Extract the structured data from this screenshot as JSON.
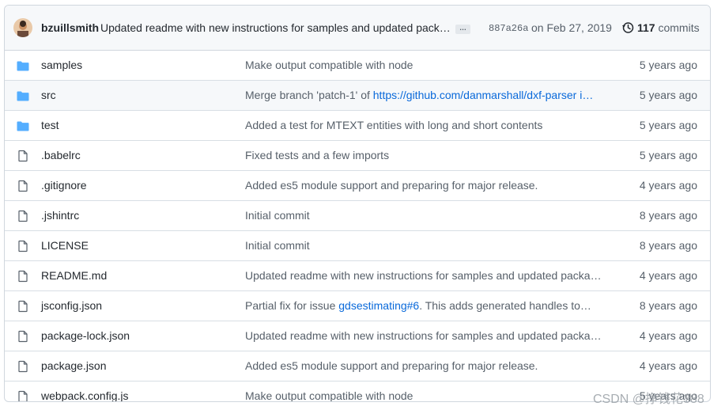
{
  "commit": {
    "author": "bzuillsmith",
    "message": "Updated readme with new instructions for samples and updated pack…",
    "more": "…",
    "sha": "887a26a",
    "date": "on Feb 27, 2019",
    "commit_count": "117",
    "commits_label": "commits"
  },
  "files": [
    {
      "type": "folder",
      "name": "samples",
      "message": "Make output compatible with node",
      "age": "5 years ago"
    },
    {
      "type": "folder",
      "name": "src",
      "message_prefix": "Merge branch 'patch-1' of ",
      "message_link": "https://github.com/danmarshall/dxf-parser i…",
      "age": "5 years ago"
    },
    {
      "type": "folder",
      "name": "test",
      "message": "Added a test for MTEXT entities with long and short contents",
      "age": "5 years ago"
    },
    {
      "type": "file",
      "name": ".babelrc",
      "message": "Fixed tests and a few imports",
      "age": "5 years ago"
    },
    {
      "type": "file",
      "name": ".gitignore",
      "message": "Added es5 module support and preparing for major release.",
      "age": "4 years ago"
    },
    {
      "type": "file",
      "name": ".jshintrc",
      "message": "Initial commit",
      "age": "8 years ago"
    },
    {
      "type": "file",
      "name": "LICENSE",
      "message": "Initial commit",
      "age": "8 years ago"
    },
    {
      "type": "file",
      "name": "README.md",
      "message": "Updated readme with new instructions for samples and updated packag…",
      "age": "4 years ago"
    },
    {
      "type": "file",
      "name": "jsconfig.json",
      "message_prefix": "Partial fix for issue ",
      "message_link": "gdsestimating#6",
      "message_suffix": ". This adds generated handles to…",
      "age": "8 years ago"
    },
    {
      "type": "file",
      "name": "package-lock.json",
      "message": "Updated readme with new instructions for samples and updated packag…",
      "age": "4 years ago"
    },
    {
      "type": "file",
      "name": "package.json",
      "message": "Added es5 module support and preparing for major release.",
      "age": "4 years ago"
    },
    {
      "type": "file",
      "name": "webpack.config.js",
      "message": "Make output compatible with node",
      "age": "5 years ago"
    }
  ],
  "watermark": "CSDN @挣钱花388",
  "colors": {
    "folder": "#54aeff",
    "file": "#57606a",
    "link": "#0969da"
  }
}
